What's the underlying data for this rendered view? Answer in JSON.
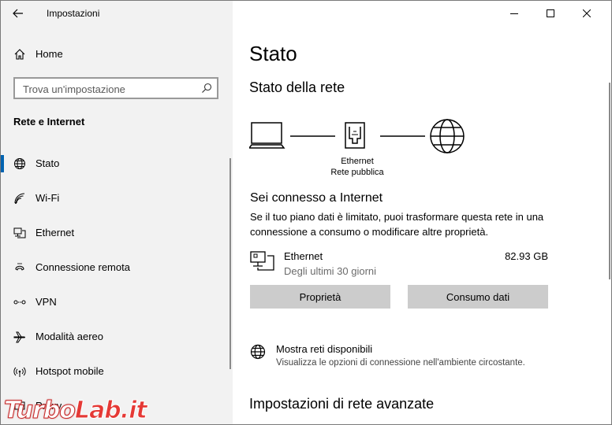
{
  "window": {
    "title": "Impostazioni"
  },
  "sidebar": {
    "home_label": "Home",
    "search_placeholder": "Trova un'impostazione",
    "section_title": "Rete e Internet",
    "items": [
      {
        "label": "Stato",
        "icon": "globe-status-icon",
        "selected": true
      },
      {
        "label": "Wi-Fi",
        "icon": "wifi-icon",
        "selected": false
      },
      {
        "label": "Ethernet",
        "icon": "ethernet-icon",
        "selected": false
      },
      {
        "label": "Connessione remota",
        "icon": "dialup-icon",
        "selected": false
      },
      {
        "label": "VPN",
        "icon": "vpn-icon",
        "selected": false
      },
      {
        "label": "Modalità aereo",
        "icon": "airplane-icon",
        "selected": false
      },
      {
        "label": "Hotspot mobile",
        "icon": "hotspot-icon",
        "selected": false
      },
      {
        "label": "Proxy",
        "icon": "proxy-icon",
        "selected": false
      }
    ]
  },
  "main": {
    "page_title": "Stato",
    "network_status_title": "Stato della rete",
    "diagram": {
      "adapter_name": "Ethernet",
      "network_type": "Rete pubblica"
    },
    "connected_title": "Sei connesso a Internet",
    "connected_desc": "Se il tuo piano dati è limitato, puoi trasformare questa rete in una connessione a consumo o modificare altre proprietà.",
    "usage": {
      "name": "Ethernet",
      "period": "Degli ultimi 30 giorni",
      "amount": "82.93 GB"
    },
    "buttons": {
      "properties": "Proprietà",
      "data_usage": "Consumo dati"
    },
    "available": {
      "title": "Mostra reti disponibili",
      "desc": "Visualizza le opzioni di connessione nell'ambiente circostante."
    },
    "advanced_title": "Impostazioni di rete avanzate"
  },
  "watermark": {
    "part1": "Turbo",
    "part2": "Lab.it"
  },
  "colors": {
    "accent": "#0063b1",
    "sidebar_bg": "#f2f2f2",
    "button_bg": "#cccccc"
  }
}
